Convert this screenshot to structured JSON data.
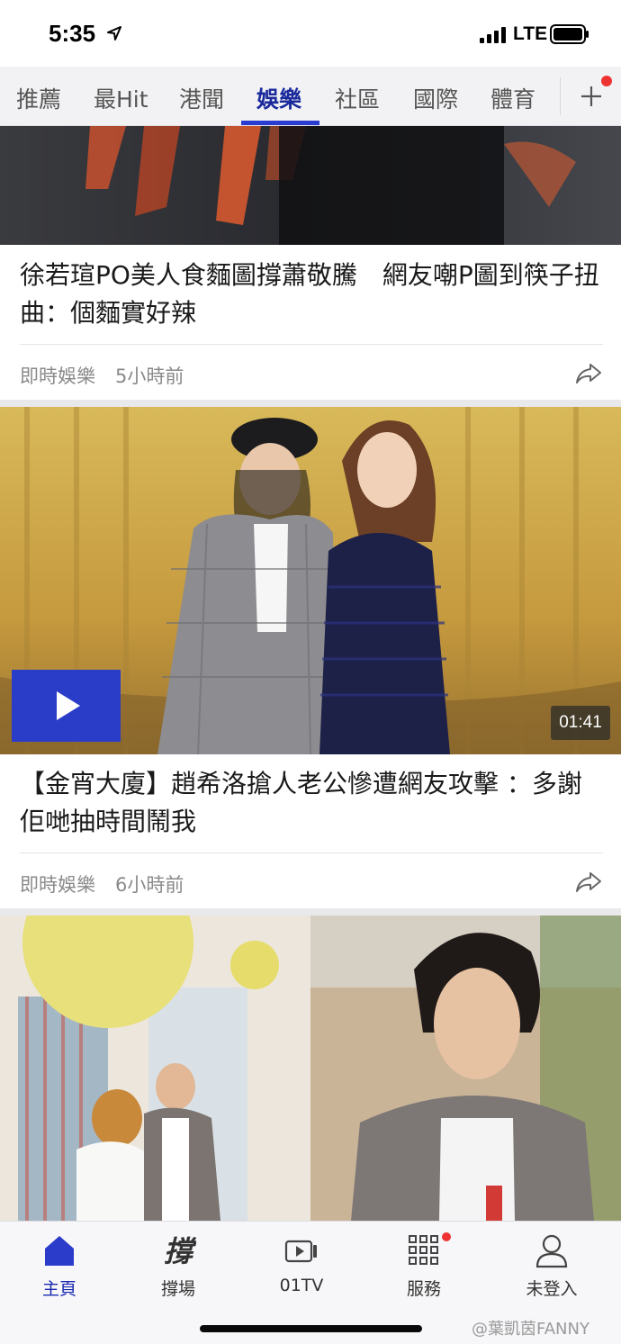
{
  "status_bar": {
    "time": "5:35",
    "network": "LTE"
  },
  "tabs": {
    "items": [
      {
        "label": "推薦"
      },
      {
        "label": "最Hit"
      },
      {
        "label": "港聞"
      },
      {
        "label": "娛樂",
        "active": true
      },
      {
        "label": "社區"
      },
      {
        "label": "國際"
      },
      {
        "label": "體育"
      }
    ],
    "add_icon": "plus-icon"
  },
  "feed": {
    "articles": [
      {
        "title": "徐若瑄PO美人食麵圖撐蕭敬騰　網友嘲P圖到筷子扭曲：個麵實好辣",
        "source": "即時娛樂",
        "time": "5小時前"
      },
      {
        "title": "【金宵大廈】趙希洛搶人老公慘遭網友攻擊 ：多謝佢哋抽時間鬧我",
        "source": "即時娛樂",
        "time": "6小時前",
        "video_duration": "01:41"
      }
    ]
  },
  "bottom_nav": {
    "items": [
      {
        "label": "主頁",
        "icon": "home-icon",
        "active": true
      },
      {
        "label": "撐場",
        "icon": "support-icon"
      },
      {
        "label": "01TV",
        "icon": "video-icon"
      },
      {
        "label": "服務",
        "icon": "grid-icon"
      },
      {
        "label": "未登入",
        "icon": "user-icon"
      }
    ]
  },
  "watermark": "@葉凱茵FANNY",
  "colors": {
    "accent": "#2b3dd1",
    "active_tab": "#1a2a9c",
    "badge": "#ee3333"
  }
}
